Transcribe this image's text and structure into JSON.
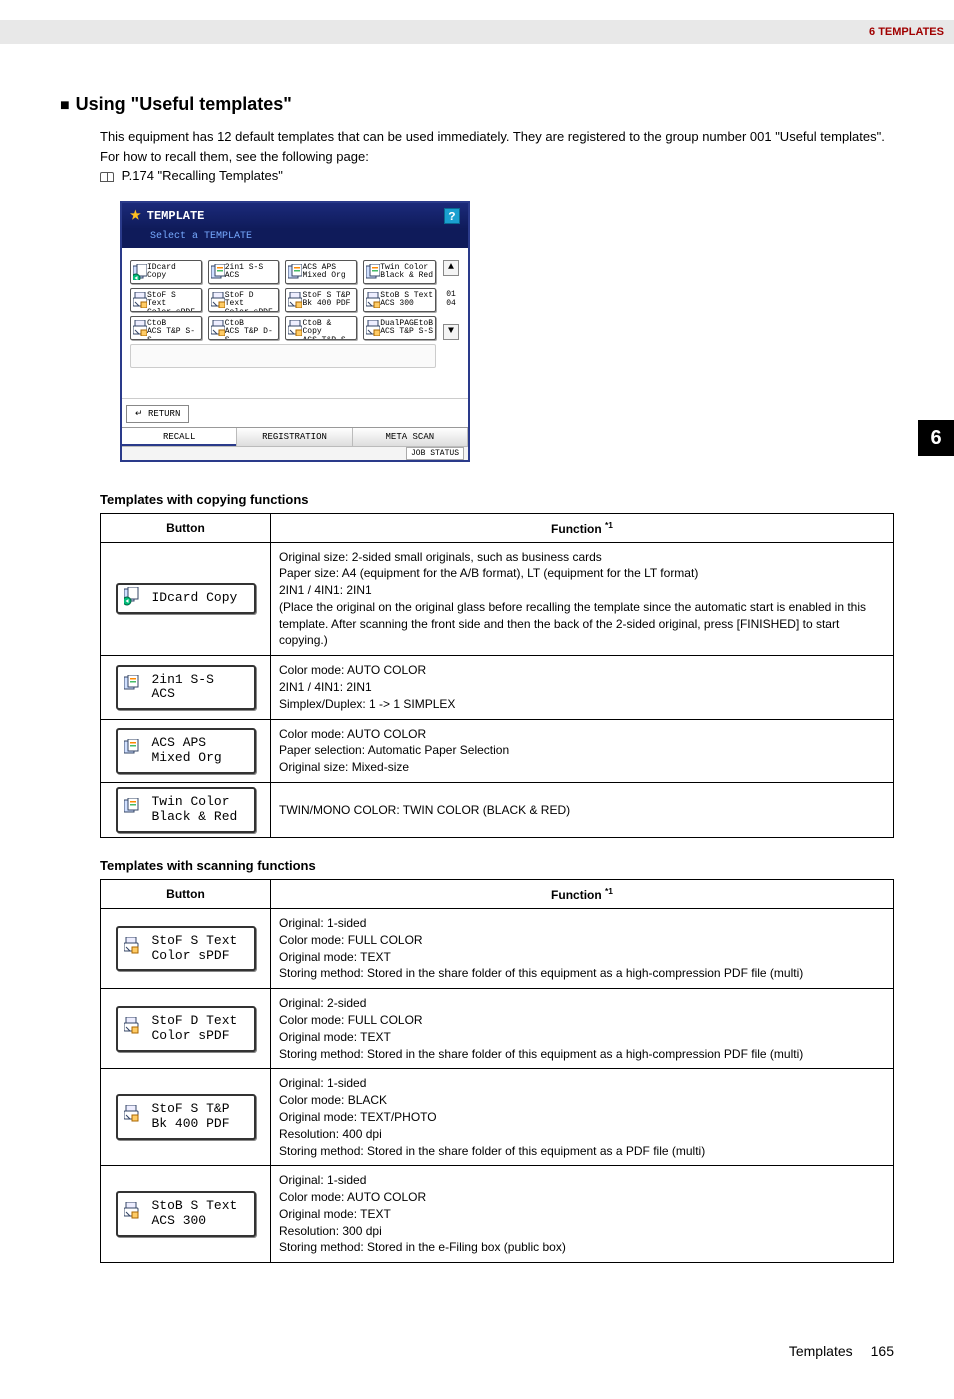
{
  "header": {
    "breadcrumb": "6 TEMPLATES"
  },
  "section": {
    "title": "Using \"Useful templates\"",
    "intro1": "This equipment has 12 default templates that can be used immediately. They are registered to the group number 001 \"Useful templates\". For how to recall them, see the following page:",
    "ref": "P.174 \"Recalling Templates\""
  },
  "panel": {
    "title": "TEMPLATE",
    "subtitle": "Select a TEMPLATE",
    "help": "?",
    "grid": {
      "r0c0": {
        "l1": "IDcard Copy",
        "l2": ""
      },
      "r0c1": {
        "l1": "2in1 S-S",
        "l2": "ACS"
      },
      "r0c2": {
        "l1": "ACS APS",
        "l2": "Mixed Org"
      },
      "r0c3": {
        "l1": "Twin Color",
        "l2": "Black & Red"
      },
      "r1c0": {
        "l1": "StoF S Text",
        "l2": "Color sPDF"
      },
      "r1c1": {
        "l1": "StoF D Text",
        "l2": "Color sPDF"
      },
      "r1c2": {
        "l1": "StoF S T&P",
        "l2": "Bk 400 PDF"
      },
      "r1c3": {
        "l1": "StoB S Text",
        "l2": "ACS 300"
      },
      "r2c0": {
        "l1": "CtoB",
        "l2": "ACS T&P S-S"
      },
      "r2c1": {
        "l1": "CtoB",
        "l2": "ACS T&P D-S"
      },
      "r2c2": {
        "l1": "CtoB & Copy",
        "l2": "ACS T&P S-D"
      },
      "r2c3": {
        "l1": "DualPAGEtoB",
        "l2": "ACS T&P S-S"
      }
    },
    "pageCount": {
      "cur": "01",
      "tot": "04"
    },
    "return": "RETURN",
    "tabs": {
      "recall": "RECALL",
      "registration": "REGISTRATION",
      "metascan": "META SCAN"
    },
    "jobStatus": "JOB STATUS"
  },
  "chapter": "6",
  "copyTable": {
    "title": "Templates with copying functions",
    "hButton": "Button",
    "hFunction": "Function ",
    "sup": "*1",
    "rows": [
      {
        "btn": {
          "l1": "IDcard Copy",
          "l2": ""
        },
        "fn": "Original size: 2-sided small originals, such as business cards\nPaper size: A4 (equipment for the A/B format), LT (equipment for the LT format)\n2IN1 / 4IN1: 2IN1\n(Place the original on the original glass before recalling the template since the automatic start is enabled in this template. After scanning the front side and then the back of the 2-sided original, press [FINISHED] to start copying.)"
      },
      {
        "btn": {
          "l1": "2in1 S-S",
          "l2": "ACS"
        },
        "fn": "Color mode: AUTO COLOR\n2IN1 / 4IN1: 2IN1\nSimplex/Duplex: 1 -> 1 SIMPLEX"
      },
      {
        "btn": {
          "l1": "ACS APS",
          "l2": "Mixed Org"
        },
        "fn": "Color mode: AUTO COLOR\nPaper selection: Automatic Paper Selection\nOriginal size: Mixed-size"
      },
      {
        "btn": {
          "l1": "Twin Color",
          "l2": "Black & Red"
        },
        "fn": "TWIN/MONO COLOR: TWIN COLOR (BLACK & RED)"
      }
    ]
  },
  "scanTable": {
    "title": "Templates with scanning functions",
    "hButton": "Button",
    "hFunction": "Function ",
    "sup": "*1",
    "rows": [
      {
        "btn": {
          "l1": "StoF S Text",
          "l2": "Color sPDF"
        },
        "fn": "Original: 1-sided\nColor mode: FULL COLOR\nOriginal mode: TEXT\nStoring method: Stored in the share folder of this equipment as a high-compression PDF file (multi)"
      },
      {
        "btn": {
          "l1": "StoF D Text",
          "l2": "Color sPDF"
        },
        "fn": "Original: 2-sided\nColor mode: FULL COLOR\nOriginal mode: TEXT\nStoring method: Stored in the share folder of this equipment as a high-compression PDF file (multi)"
      },
      {
        "btn": {
          "l1": "StoF S T&P",
          "l2": "Bk 400 PDF"
        },
        "fn": "Original: 1-sided\nColor mode: BLACK\nOriginal mode: TEXT/PHOTO\nResolution: 400 dpi\nStoring method: Stored in the share folder of this equipment as a PDF file (multi)"
      },
      {
        "btn": {
          "l1": "StoB S Text",
          "l2": "ACS 300"
        },
        "fn": "Original: 1-sided\nColor mode: AUTO COLOR\nOriginal mode: TEXT\nResolution: 300 dpi\nStoring method: Stored in the e-Filing box (public box)"
      }
    ]
  },
  "footer": {
    "label": "Templates",
    "page": "165"
  }
}
